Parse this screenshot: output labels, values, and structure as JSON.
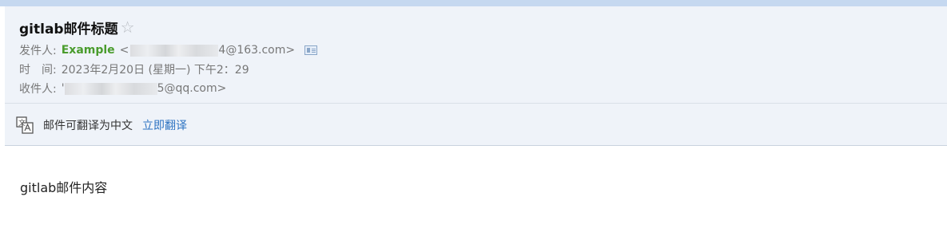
{
  "header": {
    "subject": "gitlab邮件标题",
    "star_icon": "☆",
    "from_label": "发件人:",
    "from_name": "Example",
    "from_lt": "<",
    "from_email_visible": "4@163.com>",
    "time_label": "时　间:",
    "time_value": "2023年2月20日 (星期一) 下午2：29",
    "to_label": "收件人:",
    "to_email_prefix": "'",
    "to_email_visible": "5@qq.com>"
  },
  "translate": {
    "text": "邮件可翻译为中文",
    "link": "立即翻译",
    "icon": "translate-icon"
  },
  "body": {
    "content": "gitlab邮件内容"
  },
  "colors": {
    "sender_name": "#4a9c2d",
    "link": "#2d73c2",
    "header_bg": "#eff3f9",
    "top_strip": "#c5d8f0"
  }
}
